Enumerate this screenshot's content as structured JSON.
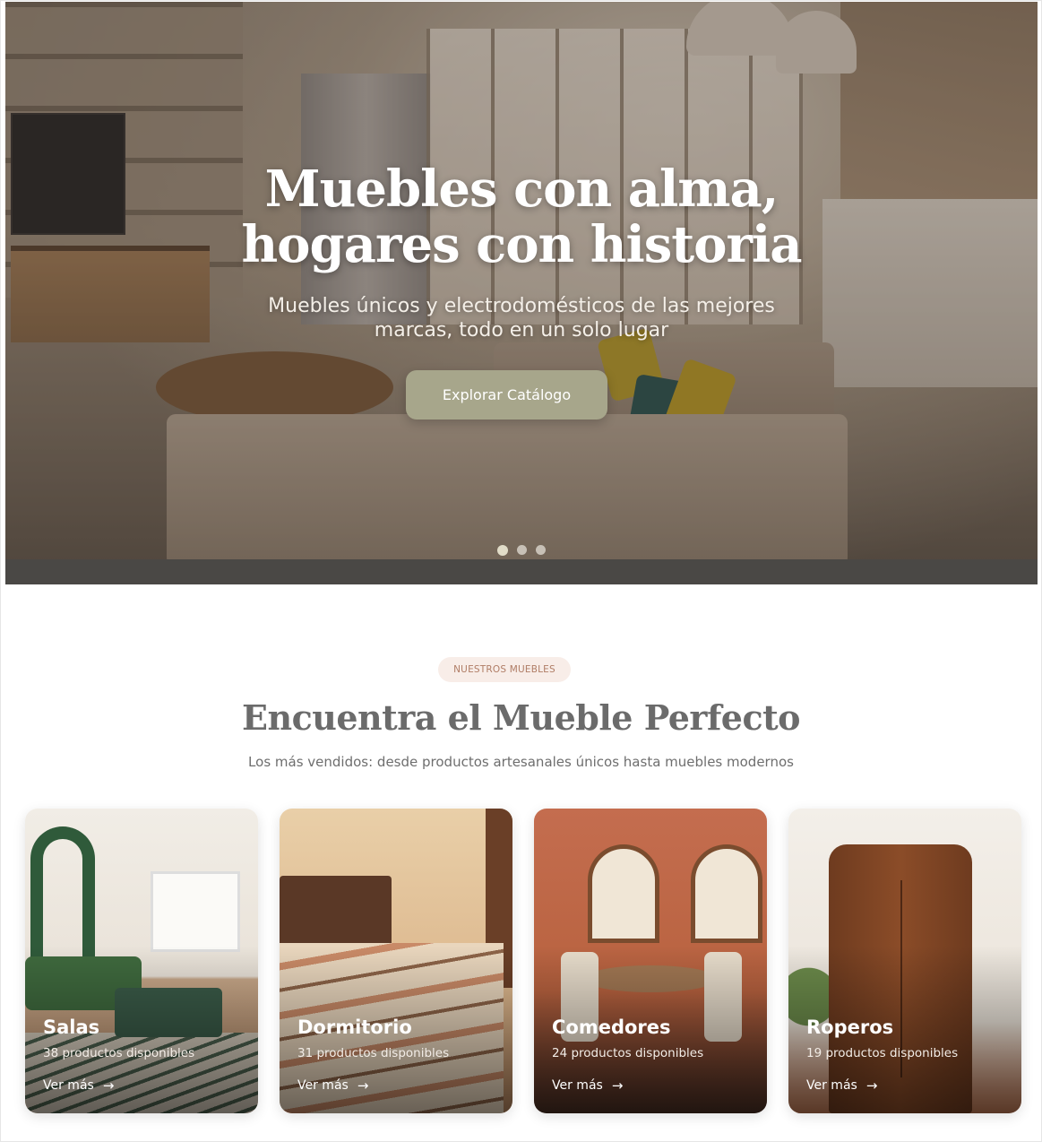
{
  "hero": {
    "title_line1": "Muebles con alma,",
    "title_line2": "hogares con historia",
    "subtitle_line1": "Muebles únicos y electrodomésticos de las mejores",
    "subtitle_line2": "marcas, todo en un solo lugar",
    "cta_label": "Explorar Catálogo",
    "carousel": {
      "total_slides": 3,
      "active_slide": 1
    }
  },
  "section": {
    "badge": "NUESTROS MUEBLES",
    "title": "Encuentra el Mueble Perfecto",
    "subtitle": "Los más vendidos: desde productos artesanales únicos hasta muebles modernos"
  },
  "categories": [
    {
      "title": "Salas",
      "count": "38 productos disponibles",
      "link": "Ver más"
    },
    {
      "title": "Dormitorio",
      "count": "31 productos disponibles",
      "link": "Ver más"
    },
    {
      "title": "Comedores",
      "count": "24 productos disponibles",
      "link": "Ver más"
    },
    {
      "title": "Roperos",
      "count": "19 productos disponibles",
      "link": "Ver más"
    }
  ],
  "colors": {
    "cta_bg": "#a7a68b",
    "badge_bg": "#f8ede8",
    "badge_text": "#b07d66",
    "section_title": "#6b6b6b"
  }
}
